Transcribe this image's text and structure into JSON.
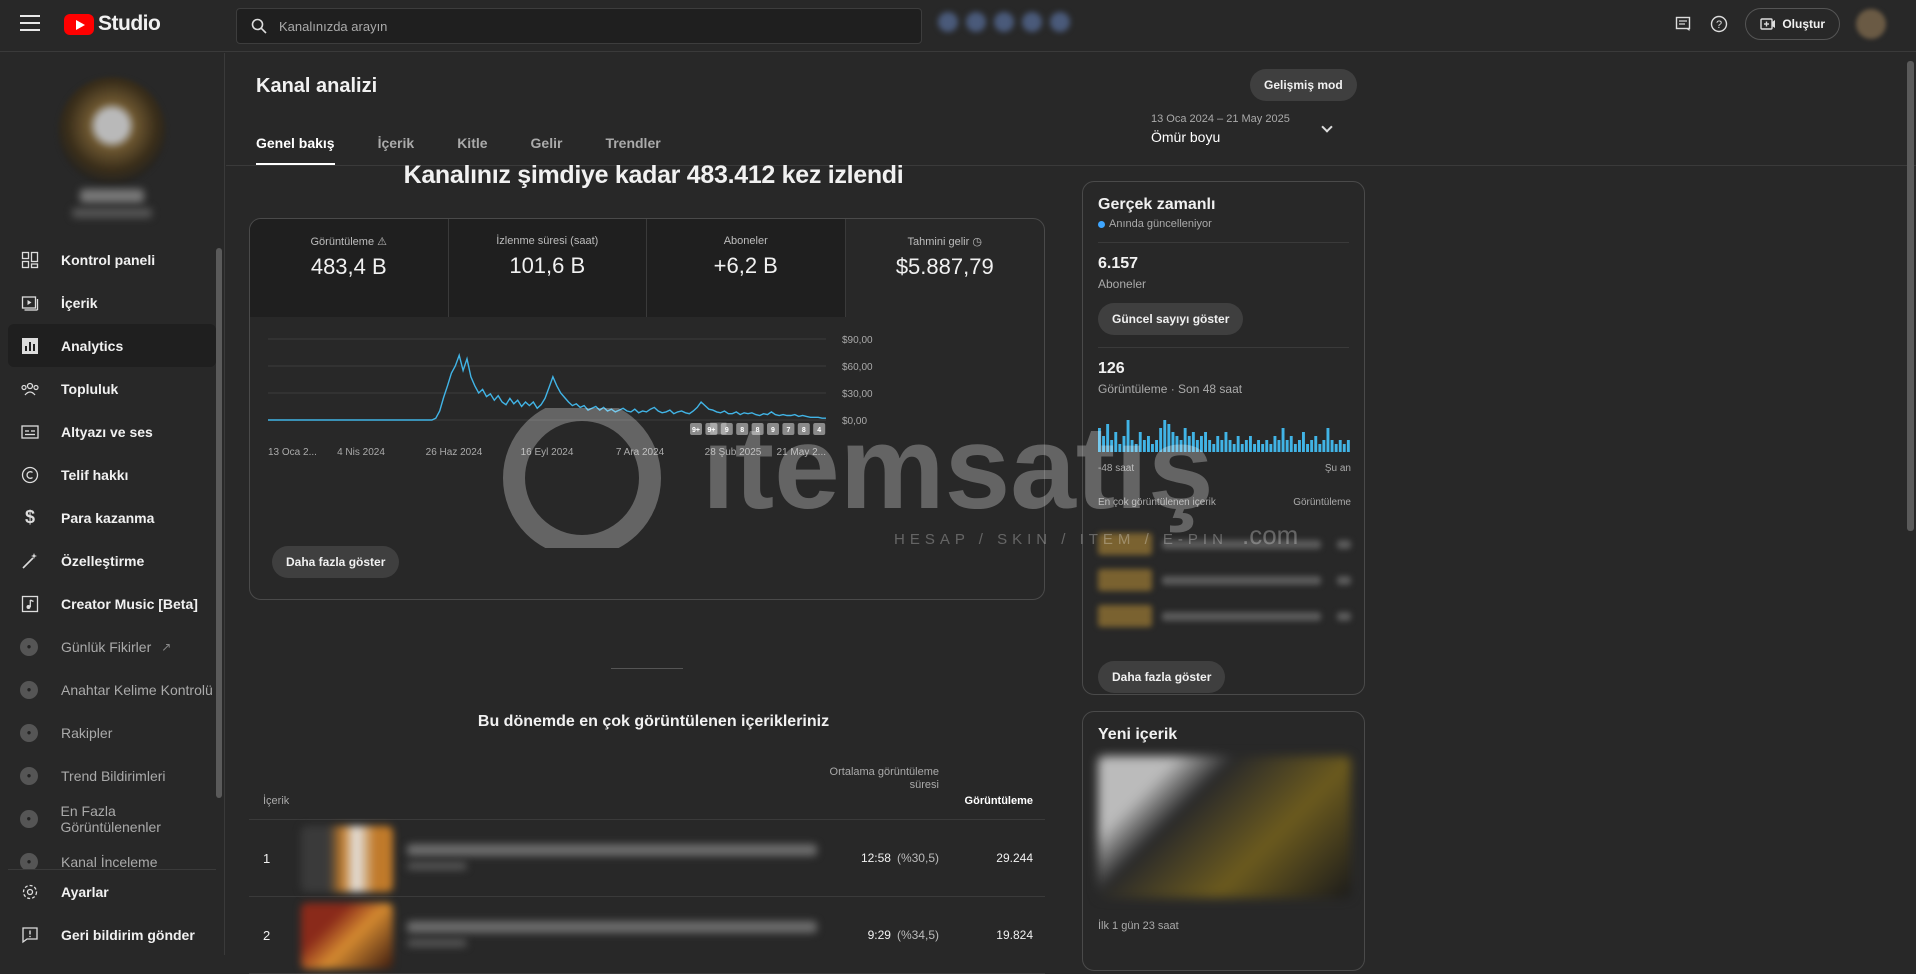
{
  "topbar": {
    "logo_text": "Studio",
    "search_placeholder": "Kanalınızda arayın",
    "create_label": "Oluştur"
  },
  "sidebar": {
    "items": [
      {
        "label": "Kontrol paneli",
        "icon": "dashboard-icon"
      },
      {
        "label": "İçerik",
        "icon": "content-icon"
      },
      {
        "label": "Analytics",
        "icon": "analytics-icon"
      },
      {
        "label": "Topluluk",
        "icon": "community-icon"
      },
      {
        "label": "Altyazı ve ses",
        "icon": "subtitles-icon"
      },
      {
        "label": "Telif hakkı",
        "icon": "copyright-icon"
      },
      {
        "label": "Para kazanma",
        "icon": "dollar-icon"
      },
      {
        "label": "Özelleştirme",
        "icon": "magic-wand-icon"
      },
      {
        "label": "Creator Music [Beta]",
        "icon": "music-icon"
      }
    ],
    "extensions": [
      {
        "label": "Günlük Fikirler"
      },
      {
        "label": "Anahtar Kelime Kontrolü"
      },
      {
        "label": "Rakipler"
      },
      {
        "label": "Trend Bildirimleri"
      },
      {
        "label": "En Fazla Görüntülenenler"
      },
      {
        "label": "Kanal İnceleme"
      }
    ],
    "bottom": [
      {
        "label": "Ayarlar",
        "icon": "gear-icon"
      },
      {
        "label": "Geri bildirim gönder",
        "icon": "feedback-icon"
      }
    ]
  },
  "header": {
    "title": "Kanal analizi",
    "advanced_mode": "Gelişmiş mod",
    "tabs": [
      "Genel bakış",
      "İçerik",
      "Kitle",
      "Gelir",
      "Trendler"
    ],
    "date_range": "13 Oca 2024 – 21 May 2025",
    "period": "Ömür boyu"
  },
  "overview": {
    "headline": "Kanalınız şimdiye kadar 483.412 kez izlendi",
    "metrics": [
      {
        "label": "Görüntüleme",
        "value": "483,4 B"
      },
      {
        "label": "İzlenme süresi (saat)",
        "value": "101,6 B"
      },
      {
        "label": "Aboneler",
        "value": "+6,2 B"
      },
      {
        "label": "Tahmini gelir",
        "value": "$5.887,79"
      }
    ],
    "show_more": "Daha fazla göster",
    "section_title": "Bu dönemde en çok görüntülenen içerikleriniz"
  },
  "chart_data": {
    "type": "line",
    "title": "",
    "selected_metric": "Tahmini gelir",
    "y_ticks": [
      "$0,00",
      "$30,00",
      "$60,00",
      "$90,00"
    ],
    "ylim": [
      0,
      90
    ],
    "x_tick_labels": [
      "13 Oca 2...",
      "4 Nis 2024",
      "26 Haz 2024",
      "16 Eyl 2024",
      "7 Ara 2024",
      "28 Şub 2025",
      "21 May 2..."
    ],
    "series": [
      {
        "values": [
          0,
          0,
          0,
          0,
          0,
          0,
          0,
          0,
          0,
          0,
          0,
          0,
          0,
          0,
          0,
          0,
          0,
          0,
          0,
          0,
          0,
          0,
          0,
          0,
          0,
          0,
          0,
          0,
          0,
          0,
          0,
          0,
          0,
          0,
          0,
          0,
          0,
          0,
          0,
          0,
          0,
          0,
          0,
          2,
          10,
          25,
          38,
          52,
          60,
          72,
          55,
          68,
          48,
          38,
          30,
          34,
          26,
          29,
          22,
          27,
          20,
          17,
          24,
          18,
          22,
          15,
          20,
          16,
          20,
          13,
          17,
          24,
          36,
          48,
          38,
          30,
          25,
          20,
          16,
          18,
          14,
          16,
          11,
          13,
          15,
          11,
          14,
          10,
          12,
          9,
          11,
          13,
          10,
          9,
          12,
          8,
          10,
          9,
          12,
          14,
          10,
          8,
          9,
          11,
          7,
          9,
          10,
          8,
          7,
          10,
          14,
          20,
          16,
          12,
          11,
          9,
          8,
          10,
          7,
          7,
          9,
          6,
          8,
          7,
          8,
          6,
          5,
          7,
          6,
          9,
          6,
          5,
          6,
          5,
          5,
          6,
          4,
          5,
          4,
          3,
          3,
          3,
          2,
          2
        ]
      }
    ],
    "upload_markers": [
      "9+",
      "9+",
      "9",
      "8",
      "8",
      "9",
      "7",
      "8",
      "4"
    ]
  },
  "top_content": {
    "col_content": "İçerik",
    "col_avg": "Ortalama görüntüleme süresi",
    "col_views": "Görüntüleme",
    "rows": [
      {
        "rank": "1",
        "avg": "12:58",
        "pct": "(%30,5)",
        "views": "29.244"
      },
      {
        "rank": "2",
        "avg": "9:29",
        "pct": "(%34,5)",
        "views": "19.824"
      }
    ]
  },
  "realtime": {
    "title": "Gerçek zamanlı",
    "live": "Anında güncelleniyor",
    "subs_value": "6.157",
    "subs_label": "Aboneler",
    "show_count": "Güncel sayıyı göster",
    "views_value": "126",
    "views_label": "Görüntüleme · Son 48 saat",
    "axis_start": "-48 saat",
    "axis_end": "Şu an",
    "top_label": "En çok görüntülenen içerik",
    "top_views": "Görüntüleme",
    "show_more": "Daha fazla göster",
    "bars": [
      6,
      4,
      7,
      3,
      5,
      2,
      4,
      8,
      3,
      2,
      5,
      3,
      4,
      2,
      3,
      6,
      8,
      7,
      5,
      4,
      3,
      6,
      4,
      5,
      3,
      4,
      5,
      3,
      2,
      4,
      3,
      5,
      3,
      2,
      4,
      2,
      3,
      4,
      2,
      3,
      2,
      3,
      2,
      4,
      3,
      6,
      3,
      4,
      2,
      3,
      5,
      2,
      3,
      4,
      2,
      3,
      6,
      3,
      2,
      3,
      2,
      3
    ]
  },
  "new_content": {
    "title": "Yeni içerik",
    "meta": "İlk 1 gün 23 saat"
  },
  "watermark": {
    "brand": "itemsatış",
    "tagline": "HESAP / SKIN / ITEM / E-PIN",
    "suffix": ".com"
  },
  "colors": {
    "accent": "#3ea6ff",
    "chart_line": "#41b4e6",
    "logo_red": "#ff0000",
    "background": "#282828"
  }
}
